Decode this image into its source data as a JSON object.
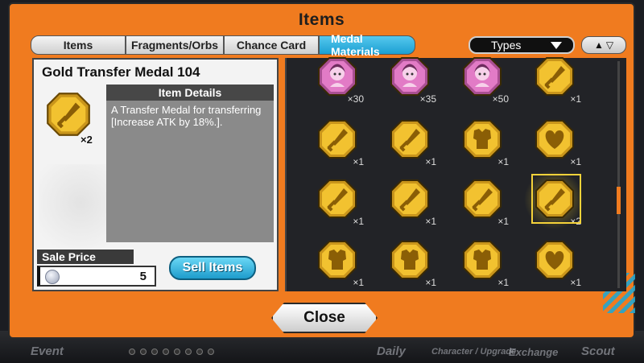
{
  "window": {
    "title": "Items"
  },
  "tabs": [
    {
      "label": "Items",
      "active": false
    },
    {
      "label": "Fragments/Orbs",
      "active": false
    },
    {
      "label": "Chance Card",
      "active": false
    },
    {
      "label": "Medal Materials",
      "active": true
    }
  ],
  "filter": {
    "types_label": "Types"
  },
  "selected_item": {
    "name": "Gold Transfer Medal 104",
    "count": "×2",
    "details_header": "Item Details",
    "description": "A Transfer Medal for transferring [Increase ATK by 18%.].",
    "sale_label": "Sale Price",
    "sale_value": "5"
  },
  "sell_button": "Sell Items",
  "close_button": "Close",
  "grid": [
    {
      "icon": "character-medal-icon",
      "count": "×30"
    },
    {
      "icon": "character-medal-icon",
      "count": "×35"
    },
    {
      "icon": "character-medal-icon",
      "count": "×50"
    },
    {
      "icon": "sword-medal-icon",
      "count": "×1"
    },
    {
      "icon": "sword-medal-icon",
      "count": "×1"
    },
    {
      "icon": "sword-medal-icon",
      "count": "×1"
    },
    {
      "icon": "armor-medal-icon",
      "count": "×1"
    },
    {
      "icon": "heart-medal-icon",
      "count": "×1"
    },
    {
      "icon": "sword-medal-icon",
      "count": "×1"
    },
    {
      "icon": "sword-medal-icon",
      "count": "×1"
    },
    {
      "icon": "sword-medal-icon",
      "count": "×1"
    },
    {
      "icon": "sword-medal-icon",
      "count": "×2"
    },
    {
      "icon": "armor-medal-icon",
      "count": "×1"
    },
    {
      "icon": "armor-medal-icon",
      "count": "×1"
    },
    {
      "icon": "armor-medal-icon",
      "count": "×1"
    },
    {
      "icon": "heart-medal-icon",
      "count": "×1"
    }
  ],
  "background_nav": [
    "Event",
    "Daily",
    "Character / Upgrade",
    "Exchange",
    "Scout"
  ],
  "colors": {
    "frame": "#f07b1f",
    "active_tab": "#1c9fd2",
    "gold": "#f2c230",
    "pink": "#e27bc6"
  }
}
